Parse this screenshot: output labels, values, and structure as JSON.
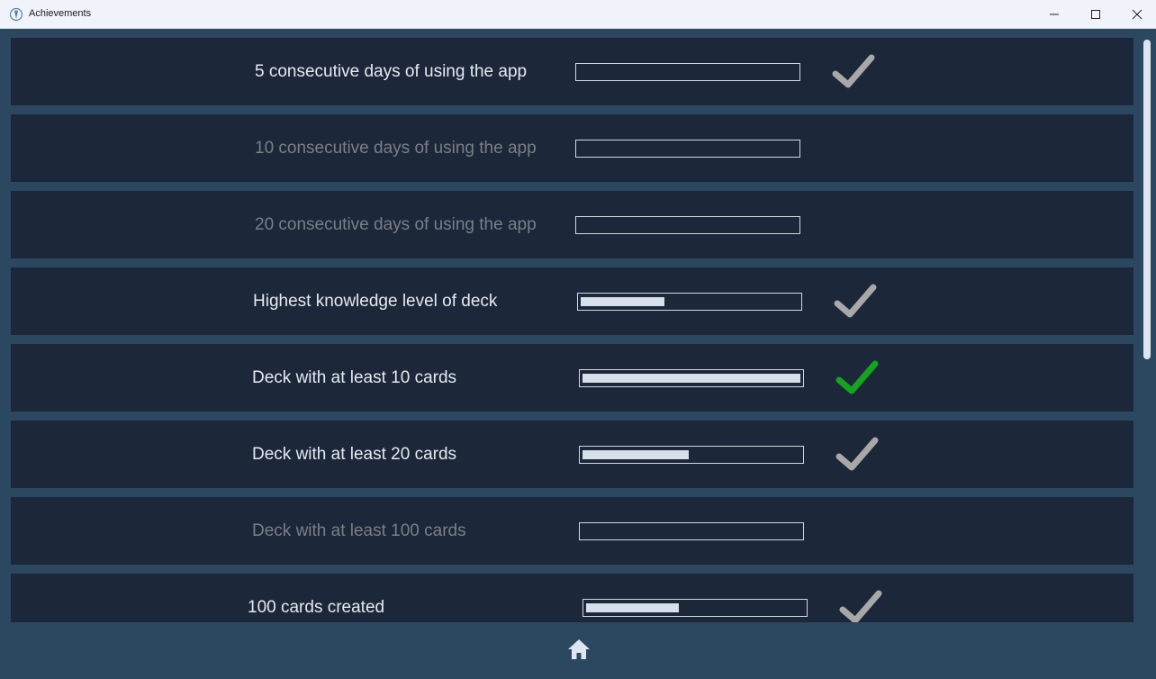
{
  "window": {
    "title": "Achievements"
  },
  "achievements": [
    {
      "label": "5 consecutive days of using the app",
      "status": "done-gray",
      "progress": 0
    },
    {
      "label": "10 consecutive days of using the app",
      "status": "locked",
      "progress": 0
    },
    {
      "label": "20 consecutive days of using the app",
      "status": "locked",
      "progress": 0
    },
    {
      "label": "Highest knowledge level of deck",
      "status": "done-gray",
      "progress": 0.38
    },
    {
      "label": "Deck with at least 10 cards",
      "status": "done-green",
      "progress": 1.0
    },
    {
      "label": "Deck with at least 20 cards",
      "status": "done-gray",
      "progress": 0.48
    },
    {
      "label": "Deck with at least 100 cards",
      "status": "locked",
      "progress": 0
    },
    {
      "label": "100 cards created",
      "status": "done-gray",
      "progress": 0.42
    }
  ],
  "colors": {
    "check_gray": "#a8a8a8",
    "check_green": "#13a51d",
    "row_bg": "#1c2739",
    "page_bg": "#2c4760"
  },
  "icons": {
    "app": "app-logo-icon",
    "home": "home-icon",
    "check": "checkmark-icon"
  }
}
